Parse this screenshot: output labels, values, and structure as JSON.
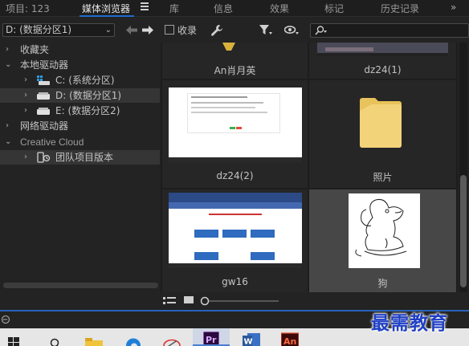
{
  "tabs": [
    {
      "label": "项目: 123",
      "active": false
    },
    {
      "label": "媒体浏览器",
      "active": true
    },
    {
      "label": "库",
      "active": false
    },
    {
      "label": "信息",
      "active": false
    },
    {
      "label": "效果",
      "active": false
    },
    {
      "label": "标记",
      "active": false
    },
    {
      "label": "历史记录",
      "active": false
    }
  ],
  "tab_more": "»",
  "toolbar": {
    "drive_value": "D: (数据分区1)",
    "ingest_label": "收录"
  },
  "tree": [
    {
      "label": "收藏夹",
      "expanded": false
    },
    {
      "label": "本地驱动器",
      "expanded": true
    },
    {
      "label": "C: (系统分区)",
      "expanded": false
    },
    {
      "label": "D: (数据分区1)",
      "expanded": false,
      "selected": true
    },
    {
      "label": "E: (数据分区2)",
      "expanded": false
    },
    {
      "label": "网络驱动器",
      "expanded": false
    },
    {
      "label": "Creative Cloud",
      "expanded": true
    },
    {
      "label": "团队项目版本",
      "expanded": false
    }
  ],
  "grid_items": [
    {
      "name": "An肖月英",
      "kind": "photo"
    },
    {
      "name": "dz24(1)",
      "kind": "screenshot"
    },
    {
      "name": "dz24(2)",
      "kind": "screenshot"
    },
    {
      "name": "照片",
      "kind": "folder"
    },
    {
      "name": "gw16",
      "kind": "screenshot"
    },
    {
      "name": "狗",
      "kind": "drawing",
      "selected": true
    }
  ],
  "watermark": "最需教育",
  "colors": {
    "accent": "#1f6bd1",
    "folder": "#f3d37a",
    "watermark": "#1f3fc4"
  },
  "taskbar_icons": [
    "windows-icon",
    "search-icon",
    "file-explorer-icon",
    "edge-icon",
    "app-icon",
    "premiere-icon",
    "word-icon",
    "animate-icon"
  ]
}
